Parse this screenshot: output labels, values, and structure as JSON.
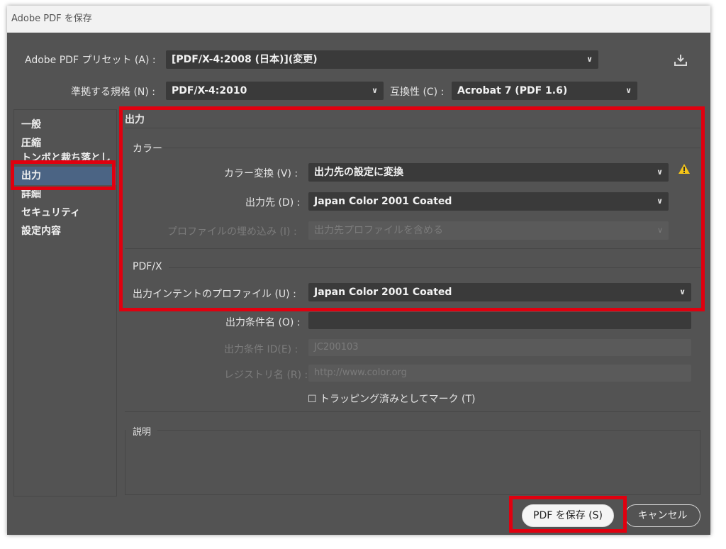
{
  "window": {
    "title": "Adobe PDF を保存"
  },
  "preset": {
    "label": "Adobe PDF プリセット (A) :",
    "value": "[PDF/X-4:2008 (日本)](変更)"
  },
  "standard": {
    "label": "準拠する規格 (N) :",
    "value": "PDF/X-4:2010"
  },
  "compat": {
    "label": "互換性 (C) :",
    "value": "Acrobat 7 (PDF 1.6)"
  },
  "sidebar": {
    "items": [
      {
        "label": "一般"
      },
      {
        "label": "圧縮"
      },
      {
        "label": "トンボと裁ち落とし"
      },
      {
        "label": "出力"
      },
      {
        "label": "詳細"
      },
      {
        "label": "セキュリティ"
      },
      {
        "label": "設定内容"
      }
    ],
    "selected_index": 3
  },
  "output": {
    "header": "出力",
    "color_group": "カラー",
    "color_conversion": {
      "label": "カラー変換 (V) :",
      "value": "出力先の設定に変換"
    },
    "destination": {
      "label": "出力先 (D) :",
      "value": "Japan Color 2001 Coated"
    },
    "profile_embed": {
      "label": "プロファイルの埋め込み (I) :",
      "value": "出力先プロファイルを含める"
    },
    "pdfx_group": "PDF/X",
    "intent_profile": {
      "label": "出力インテントのプロファイル (U) :",
      "value": "Japan Color 2001 Coated"
    },
    "condition_name": {
      "label": "出力条件名 (O) :",
      "value": ""
    },
    "condition_id": {
      "label": "出力条件 ID(E) :",
      "value": "JC200103"
    },
    "registry": {
      "label": "レジストリ名 (R) :",
      "value": "http://www.color.org"
    },
    "trapped": {
      "box": "☐",
      "label": "トラッピング済みとしてマーク (T)"
    }
  },
  "description": {
    "label": "説明"
  },
  "buttons": {
    "save": "PDF を保存 (S)",
    "cancel": "キャンセル"
  },
  "colors": {
    "highlight": "#e0000f",
    "selected_bg": "#4b6484",
    "dialog_bg": "#535353",
    "warning": "#f5c518"
  }
}
